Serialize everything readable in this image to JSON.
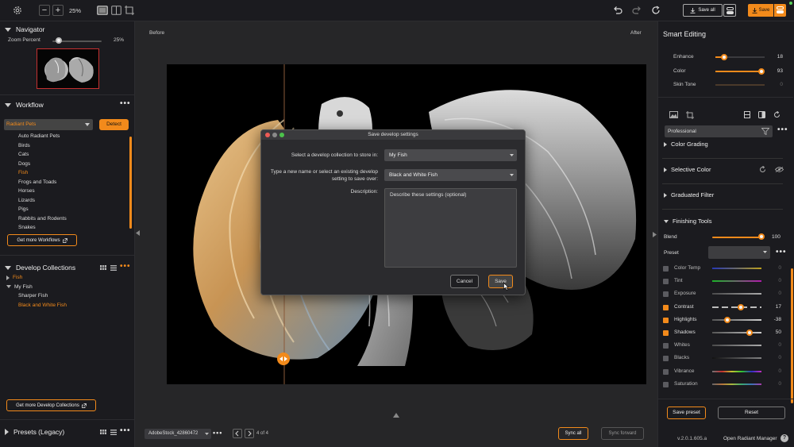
{
  "toolbar": {
    "zoom": "25%",
    "save_all": "Save all",
    "save": "Save"
  },
  "navigator": {
    "title": "Navigator",
    "zoom_label": "Zoom Percent",
    "zoom_value": "25%",
    "zoom_fraction": 0.25
  },
  "workflow": {
    "title": "Workflow",
    "selected": "Radiant Pets",
    "detect": "Detect",
    "items": [
      "Auto Radiant Pets",
      "Birds",
      "Cats",
      "Dogs",
      "Fish",
      "Frogs and Toads",
      "Horses",
      "Lizards",
      "Pigs",
      "Rabbits and Rodents",
      "Snakes"
    ],
    "active_item": "Fish",
    "get_more": "Get more Workflows"
  },
  "develop_collections": {
    "title": "Develop Collections",
    "tree": [
      {
        "label": "Fish",
        "expanded": false,
        "active": true,
        "level": 0
      },
      {
        "label": "My Fish",
        "expanded": true,
        "active": false,
        "level": 0
      },
      {
        "label": "Sharper Fish",
        "active": false,
        "level": 1
      },
      {
        "label": "Black and White Fish",
        "active": true,
        "level": 1
      }
    ],
    "get_more": "Get more Develop Collections"
  },
  "presets": {
    "title": "Presets (Legacy)"
  },
  "canvas": {
    "before": "Before",
    "after": "After",
    "filename": "AdobeStock_42860472",
    "page": "4 of 4",
    "sync_all": "Sync all",
    "sync_forward": "Sync forward"
  },
  "dialog": {
    "title": "Save develop settings",
    "collection_label": "Select a develop collection to store in:",
    "collection_value": "My Fish",
    "name_label_1": "Type a new name or select an existing develop",
    "name_label_2": "setting to save over:",
    "name_value": "Black and White Fish",
    "description_label": "Description:",
    "description_placeholder": "Describe these settings (optional)",
    "cancel": "Cancel",
    "save": "Save"
  },
  "smart_editing": {
    "title": "Smart Editing",
    "sliders": [
      {
        "label": "Enhance",
        "value": "18",
        "fraction": 0.18
      },
      {
        "label": "Color",
        "value": "93",
        "fraction": 0.93
      },
      {
        "label": "Skin Tone",
        "value": "0",
        "fraction": 0
      }
    ]
  },
  "right_panel": {
    "preset_select": "Professional",
    "sections": [
      "Color Grading",
      "Selective Color",
      "Graduated Filter",
      "Finishing Tools"
    ],
    "blend_label": "Blend",
    "blend_value": "100",
    "preset_label": "Preset",
    "finishing": [
      {
        "label": "Color Temp",
        "value": "0",
        "checked": false,
        "fraction": null,
        "track": "temp"
      },
      {
        "label": "Tint",
        "value": "0",
        "checked": false,
        "fraction": null,
        "track": "tint"
      },
      {
        "label": "Exposure",
        "value": "0",
        "checked": false,
        "fraction": null,
        "track": "grey"
      },
      {
        "label": "Contrast",
        "value": "17",
        "checked": true,
        "fraction": 0.585,
        "track": "dash"
      },
      {
        "label": "Highlights",
        "value": "-38",
        "checked": true,
        "fraction": 0.31,
        "track": "grey"
      },
      {
        "label": "Shadows",
        "value": "50",
        "checked": true,
        "fraction": 0.75,
        "track": "grey"
      },
      {
        "label": "Whites",
        "value": "0",
        "checked": false,
        "fraction": null,
        "track": "grey"
      },
      {
        "label": "Blacks",
        "value": "0",
        "checked": false,
        "fraction": null,
        "track": "dark"
      },
      {
        "label": "Vibrance",
        "value": "0",
        "checked": false,
        "fraction": null,
        "track": "rainbow"
      },
      {
        "label": "Saturation",
        "value": "0",
        "checked": false,
        "fraction": null,
        "track": "rainbow2"
      }
    ],
    "save_preset": "Save preset",
    "reset": "Reset",
    "version": "v.2.0.1.605.a",
    "open_manager": "Open Radiant Manager"
  },
  "colors": {
    "accent": "#f28a1b",
    "panel": "#1b1b1f",
    "canvas": "#262628"
  }
}
